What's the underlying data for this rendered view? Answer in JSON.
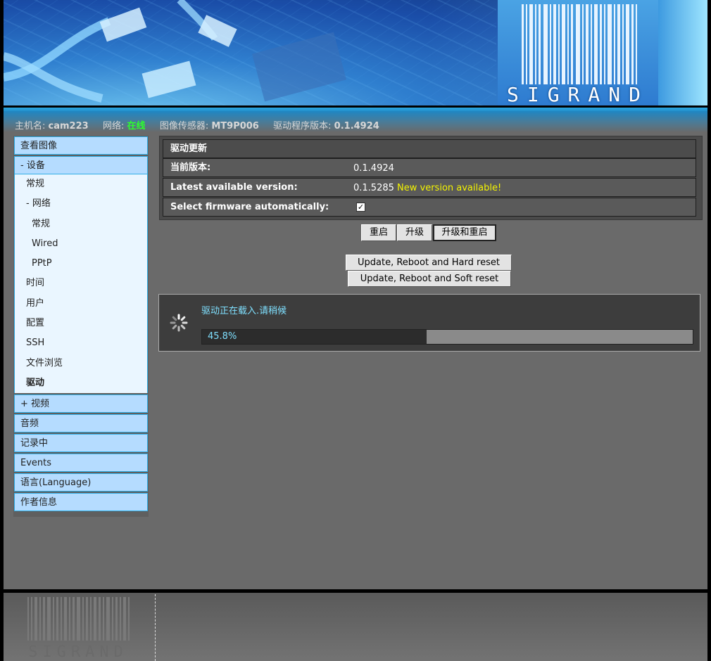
{
  "brand": {
    "logo_text": "SIGRAND"
  },
  "status": {
    "hostname_label": "主机名:",
    "hostname": "cam223",
    "network_label": "网络:",
    "network": "在线",
    "sensor_label": "图像传感器:",
    "sensor": "MT9P006",
    "driver_label": "驱动程序版本:",
    "driver_version": "0.1.4924"
  },
  "sidebar": {
    "view_image": "查看图像",
    "device": "- 设备",
    "general": "常规",
    "network": "- 网络",
    "net_general": "常规",
    "wired": "Wired",
    "pptp": "PPtP",
    "time": "时间",
    "users": "用户",
    "config": "配置",
    "ssh": "SSH",
    "file_browser": "文件浏览",
    "driver": "驱动",
    "video": "+ 视频",
    "audio": "音频",
    "recording": "记录中",
    "events": "Events",
    "language": "语言(Language)",
    "about": "作者信息"
  },
  "panel": {
    "title": "驱动更新",
    "current_label": "当前版本:",
    "current_value": "0.1.4924",
    "latest_label": "Latest available version:",
    "latest_value": "0.1.5285",
    "latest_note": "New version available!",
    "auto_label": "Select firmware automatically:",
    "auto_checked": "✓"
  },
  "buttons": {
    "reboot": "重启",
    "upgrade": "升级",
    "upgrade_reboot": "升级和重启",
    "hard_reset": "Update, Reboot and Hard reset",
    "soft_reset": "Update, Reboot and Soft reset"
  },
  "progress": {
    "message": "驱动正在载入.请稍候",
    "percent_text": "45.8%",
    "fraction": 0.458
  },
  "colors": {
    "online": "#2cff2c",
    "new_version": "#f4f400",
    "progress_text": "#7fe0ff",
    "nav_bg": "#b5dcff",
    "nav_border": "#2faee6"
  }
}
